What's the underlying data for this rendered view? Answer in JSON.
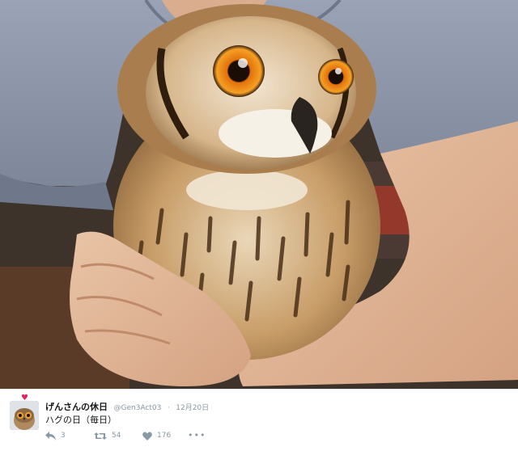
{
  "photo": {
    "alt_icon": "owl-photo",
    "colors": {
      "shirt": "#8a93a6",
      "skin": "#e3b89a",
      "owl_feather": "#c69a68",
      "eye": "#f08a12",
      "background": "#3a302a"
    }
  },
  "tweet": {
    "display_name": "げんさんの休日",
    "handle": "@Gen3Act03",
    "separator": "·",
    "timestamp": "12月20日",
    "text": "ハグの日（毎日）",
    "avatar_badge": "♥",
    "actions": {
      "reply_icon": "reply-icon",
      "reply_count": "3",
      "retweet_icon": "retweet-icon",
      "retweet_count": "54",
      "like_icon": "heart-icon",
      "like_count": "176",
      "more_icon": "more-icon",
      "more_label": "•••"
    }
  }
}
